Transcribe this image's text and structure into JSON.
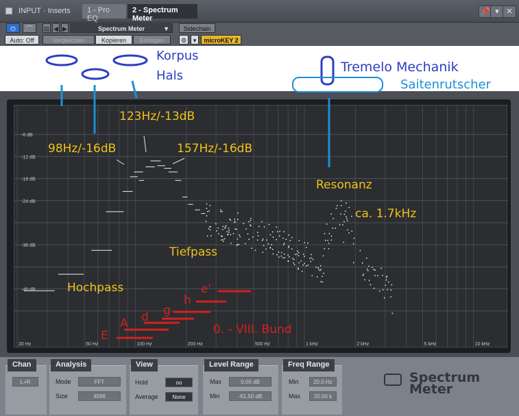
{
  "titlebar": {
    "title": "INPUT · Inserts",
    "tab_inactive": "1 - Pro EQ",
    "tab_active": "2 - Spectrum Meter",
    "pin_glyph": "📌",
    "menu_glyph": "▾",
    "close_glyph": "✕"
  },
  "toolbar": {
    "power_glyph": "⏻",
    "curve_glyph": "⌒",
    "preset_glyph": "▤",
    "prev_glyph": "◀",
    "next_glyph": "▶",
    "preset_name": "Spectrum Meter",
    "preset_arrow": "▼",
    "sidechain": "Sidechain",
    "auto": "Auto: Off",
    "compare": "Vergleichen",
    "copy": "Kopieren",
    "paste": "Einfügen",
    "gear_glyph": "⚙",
    "dropdown_glyph": "▾",
    "device": "microKEY 2"
  },
  "spectrum": {
    "db_labels": [
      "-6 dB",
      "-12 dB",
      "-18 dB",
      "-24 dB",
      "-36 dB",
      "-48 dB"
    ],
    "freq_labels": [
      "20 Hz",
      "50 Hz",
      "100 Hz",
      "200 Hz",
      "500 Hz",
      "1 kHz",
      "2 kHz",
      "5 kHz",
      "10 kHz"
    ]
  },
  "annotations": {
    "korpus": "Korpus",
    "hals": "Hals",
    "tremelo": "Tremelo Mechanik",
    "saitenrutscher": "Saitenrutscher",
    "peak_123": "123Hz/-13dB",
    "peak_98": "98Hz/-16dB",
    "peak_157": "157Hz/-16dB",
    "resonanz": "Resonanz",
    "resonanz_freq": "ca. 1.7kHz",
    "tiefpass": "Tiefpass",
    "hochpass": "Hochpass",
    "notes": [
      "E",
      "A",
      "d",
      "g",
      "h",
      "e'"
    ],
    "bund": "0. - VIII. Bund"
  },
  "bottom": {
    "chan": {
      "title": "Chan",
      "button": "L+R"
    },
    "analysis": {
      "title": "Analysis",
      "mode_label": "Mode",
      "mode_value": "FFT",
      "size_label": "Size",
      "size_value": "4096"
    },
    "view": {
      "title": "View",
      "hold_label": "Hold",
      "hold_value": "oo",
      "average_label": "Average",
      "average_value": "None"
    },
    "level_range": {
      "title": "Level Range",
      "max_label": "Max",
      "max_value": "0.00 dB",
      "min_label": "Min",
      "min_value": "-61.50 dB"
    },
    "freq_range": {
      "title": "Freq Range",
      "min_label": "Min",
      "min_value": "20.0 Hz",
      "max_label": "Max",
      "max_value": "20.00 k"
    },
    "logo_line1": "Spectrum",
    "logo_line2": "Meter"
  },
  "colors": {
    "annotation_blue": "#2b3fbf",
    "annotation_cyan": "#1d8fd6",
    "annotation_yellow": "#f2c21b",
    "annotation_red": "#d62020"
  }
}
